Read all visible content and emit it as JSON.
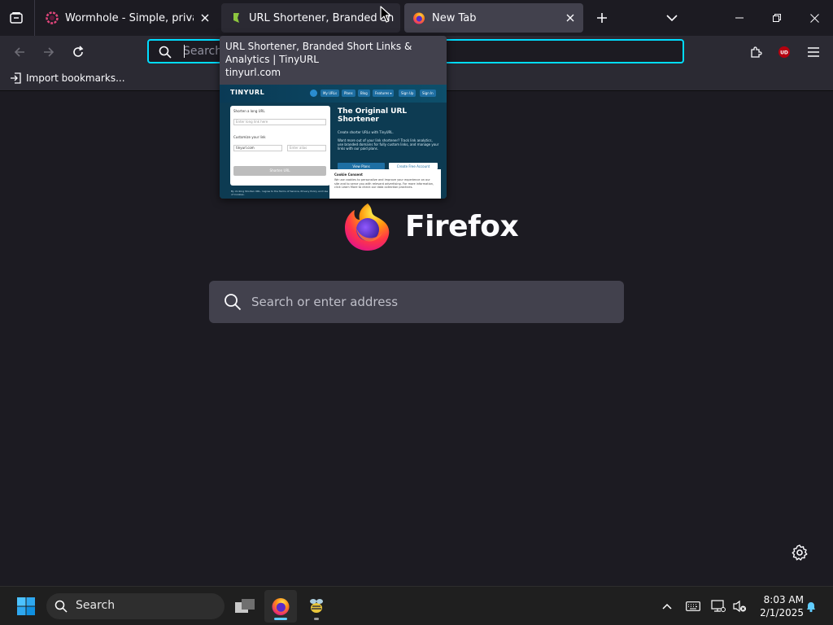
{
  "colors": {
    "accent": "#00ddff",
    "tab_active": "#42414d",
    "toolbar": "#2b2a33",
    "background": "#1c1b22",
    "taskbar_accent": "#60cdff"
  },
  "tabs": [
    {
      "title": "Wormhole - Simple, private file sharing",
      "favicon": "wormhole-icon"
    },
    {
      "title": "URL Shortener, Branded Short Links & Analytics | TinyURL",
      "favicon": "bookmark-flag-icon"
    },
    {
      "title": "New Tab",
      "favicon": "firefox-icon",
      "selected": true
    }
  ],
  "urlbar": {
    "placeholder": "Search or enter address",
    "value": ""
  },
  "bookmarks_bar": {
    "import_label": "Import bookmarks..."
  },
  "tooltip": {
    "title": "URL Shortener, Branded Short Links & Analytics | TinyURL",
    "url": "tinyurl.com",
    "preview": {
      "brand": "TINYURL",
      "nav": [
        "My URLs",
        "Plans",
        "Blog",
        "Features ▾",
        "Sign Up",
        "Sign In"
      ],
      "shorten_label": "Shorten a long URL",
      "long_url_placeholder": "Enter long link here",
      "customize_label": "Customize your link",
      "domain_value": "tinyurl.com",
      "alias_placeholder": "Enter alias",
      "shorten_button": "Shorten URL",
      "hero": "The Original URL Shortener",
      "hero_sub": "Create shorter URLs with TinyURL.",
      "hero_body": "Want more out of your link shortener? Track link analytics, use branded domains for fully custom links, and manage your links with our paid plans.",
      "plans_button": "View Plans",
      "free_button": "Create Free Account",
      "cookie_heading": "Cookie Consent",
      "cookie_body": "We use cookies to personalize and improve your experience on our site and to serve you with relevant advertising. For more information, click Learn More to check our data collection practices.",
      "footer": "By clicking Shorten URL, I agree to the Terms of Service, Privacy Policy and Use of Cookies."
    }
  },
  "newtab": {
    "wordmark": "Firefox",
    "search_placeholder": "Search or enter address"
  },
  "taskbar": {
    "search_label": "Search",
    "clock_time": "8:03 AM",
    "clock_date": "2/1/2025"
  }
}
